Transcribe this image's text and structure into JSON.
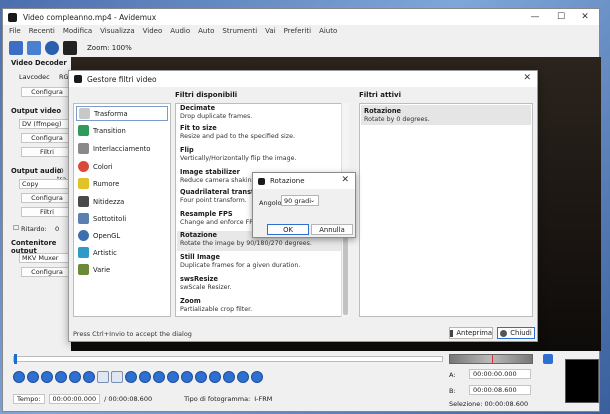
{
  "window": {
    "title": "Video compleanno.mp4 - Avidemux",
    "minimize": "—",
    "maximize": "☐",
    "close": "✕"
  },
  "menu": [
    "File",
    "Recenti",
    "Modifica",
    "Visualizza",
    "Video",
    "Audio",
    "Auto",
    "Strumenti",
    "Vai",
    "Preferiti",
    "Aiuto"
  ],
  "toolbar": {
    "zoom": "Zoom: 100%"
  },
  "left_panel": {
    "video_decoder": "Video Decoder",
    "lavcodec": "Lavcodec",
    "rgb": "RGB",
    "configura1": "Configura",
    "output_video": "Output video",
    "video_codec": "DV (ffmpeg)",
    "configura2": "Configura",
    "filtri1": "Filtri",
    "output_audio": "Output audio",
    "audio_tracks": "(0 tra",
    "audio_codec": "Copy",
    "configura3": "Configura",
    "filtri2": "Filtri",
    "ritardo": "Ritardo:",
    "ritardo_value": "0",
    "contenitore": "Contenitore output",
    "container": "MKV Muxer",
    "configura4": "Configura"
  },
  "filter_dialog": {
    "title": "Gestore filtri video",
    "close": "✕",
    "categories": [
      {
        "label": "Trasforma",
        "color": "#c8c8c8"
      },
      {
        "label": "Transition",
        "color": "#2f9a5a"
      },
      {
        "label": "Interlacciamento",
        "color": "#8a8a8a"
      },
      {
        "label": "Colori",
        "color": "#d94a3a"
      },
      {
        "label": "Rumore",
        "color": "#e0c22a"
      },
      {
        "label": "Nitidezza",
        "color": "#4a4a4a"
      },
      {
        "label": "Sottotitoli",
        "color": "#5a7fb0"
      },
      {
        "label": "OpenGL",
        "color": "#3a6fb0"
      },
      {
        "label": "Artistic",
        "color": "#2f9ac8"
      },
      {
        "label": "Varie",
        "color": "#6a8a3a"
      }
    ],
    "available_title": "Filtri disponibili",
    "available": [
      {
        "name": "Decimate",
        "desc": "Drop duplicate frames."
      },
      {
        "name": "Fit to size",
        "desc": "Resize and pad to the specified size."
      },
      {
        "name": "Flip",
        "desc": "Vertically/Horizontally flip the image."
      },
      {
        "name": "Image stabilizer",
        "desc": "Reduce camera shakiness."
      },
      {
        "name": "Quadrilateral transformation",
        "desc": "Four point transform."
      },
      {
        "name": "Resample FPS",
        "desc": "Change and enforce FPS. Keep duration and sync."
      },
      {
        "name": "Rotazione",
        "desc": "Rotate the image by 90/180/270 degrees."
      },
      {
        "name": "Still Image",
        "desc": "Duplicate frames for a given duration."
      },
      {
        "name": "swsResize",
        "desc": "swScale Resizer."
      },
      {
        "name": "Zoom",
        "desc": "Partializable crop filter."
      }
    ],
    "active_title": "Filtri attivi",
    "active": {
      "name": "Rotazione",
      "desc": "Rotate by 0 degrees."
    },
    "hint": "Press Ctrl+Invio to accept the dialog",
    "preview": "Anteprima",
    "chiudi": "Chiudi"
  },
  "rotation_dialog": {
    "title": "Rotazione",
    "close": "✕",
    "angle_label": "Angolo:",
    "angle_value": "90 gradi",
    "ok": "OK",
    "cancel": "Annulla"
  },
  "status": {
    "tempo": "Tempo:",
    "current_time": "00:00:00.000",
    "total_time": "/ 00:00:08.600",
    "frame_type": "Tipo di fotogramma:",
    "frame_value": "I-FRM",
    "a_label": "A:",
    "a_value": "00:00:00.000",
    "b_label": "B:",
    "b_value": "00:00:08.600",
    "selection": "Selezione: 00:00:08.600"
  }
}
